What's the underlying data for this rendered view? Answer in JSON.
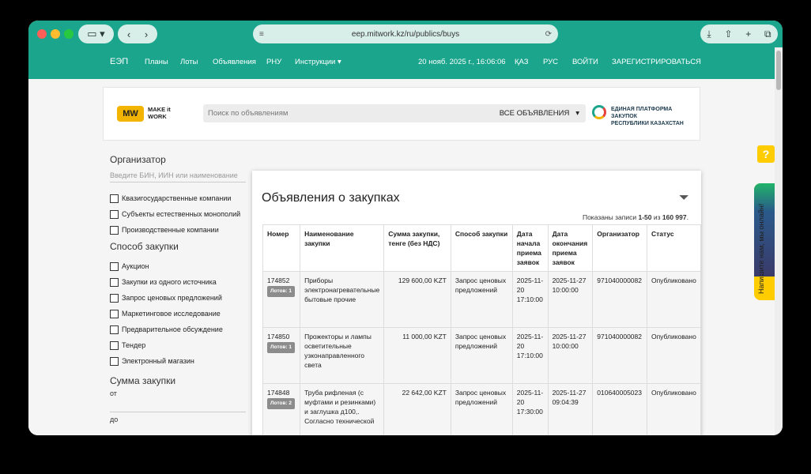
{
  "browser": {
    "url": "eep.mitwork.kz/ru/publics/buys"
  },
  "header": {
    "brand": "ЕЭП",
    "nav": [
      "Планы",
      "Лоты",
      "Объявления",
      "РНУ",
      "Инструкции"
    ],
    "datetime": "20 нояб. 2025 г., 16:06:06",
    "lang_kz": "ҚАЗ",
    "lang_ru": "РУС",
    "login": "ВОЙТИ",
    "register": "ЗАРЕГИСТРИРОВАТЬСЯ"
  },
  "search": {
    "logo_mw": "MW",
    "logo_line1": "MAKE it",
    "logo_line2": "WORK",
    "placeholder": "Поиск по объявлениям",
    "selected": "ВСЕ ОБЪЯВЛЕНИЯ",
    "gov_line1": "ЕДИНАЯ ПЛАТФОРМА ЗАКУПОК",
    "gov_line2": "РЕСПУБЛИКИ КАЗАХСТАН"
  },
  "filters": {
    "organizer_title": "Организатор",
    "organizer_placeholder": "Введите БИН, ИИН или наименование",
    "organizer_options": [
      "Квазигосударственные компании",
      "Субъекты естественных монополий",
      "Производственные компании"
    ],
    "method_title": "Способ закупки",
    "method_options": [
      "Аукцион",
      "Закупки из одного источника",
      "Запрос ценовых предложений",
      "Маркетинговое исследование",
      "Предварительное обсуждение",
      "Тендер",
      "Электронный магазин"
    ],
    "sum_title": "Сумма закупки",
    "from_label": "от",
    "to_label": "до"
  },
  "main": {
    "title": "Объявления о закупках",
    "shown_prefix": "Показаны записи",
    "shown_range": "1-50",
    "shown_of": "из",
    "shown_total": "160 997",
    "columns": [
      "Номер",
      "Наименование закупки",
      "Сумма закупки, тенге (без НДС)",
      "Способ закупки",
      "Дата начала приема заявок",
      "Дата окончания приема заявок",
      "Организатор",
      "Статус"
    ],
    "rows": [
      {
        "number": "174852",
        "lots": "Лотов: 1",
        "name": "Приборы электронагревательные бытовые прочие",
        "sum": "129 600,00 KZT",
        "method": "Запрос ценовых предложений",
        "start": "2025-11-20 17:10:00",
        "end": "2025-11-27 10:00:00",
        "org": "971040000082",
        "status": "Опубликовано"
      },
      {
        "number": "174850",
        "lots": "Лотов: 1",
        "name": "Прожекторы и лампы осветительные узконаправленного света",
        "sum": "11 000,00 KZT",
        "method": "Запрос ценовых предложений",
        "start": "2025-11-20 17:10:00",
        "end": "2025-11-27 10:00:00",
        "org": "971040000082",
        "status": "Опубликовано"
      },
      {
        "number": "174848",
        "lots": "Лотов: 2",
        "name": "Труба рифленая (с муфтами и резинками) и заглушка д100,. Согласно технической",
        "sum": "22 642,00 KZT",
        "method": "Запрос ценовых предложений",
        "start": "2025-11-20 17:30:00",
        "end": "2025-11-27 09:04:39",
        "org": "010640005023",
        "status": "Опубликовано"
      }
    ]
  },
  "widgets": {
    "help": "?",
    "chat": "Напишите нам, мы онлайн!"
  }
}
